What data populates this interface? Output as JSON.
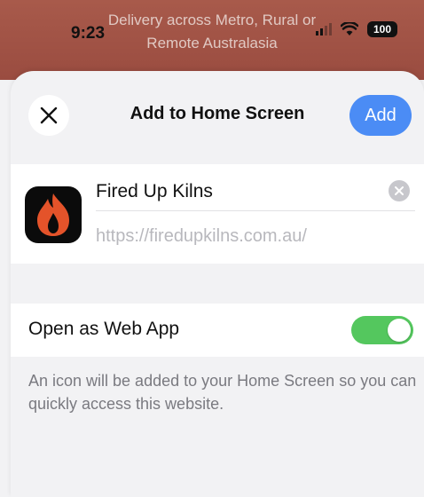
{
  "status": {
    "time": "9:23",
    "battery": "100"
  },
  "banner": {
    "line1": "Delivery across Metro, Rural or",
    "line2": "Remote Australasia"
  },
  "sheet": {
    "title": "Add to Home Screen",
    "add_label": "Add",
    "app_name": "Fired Up Kilns",
    "url": "https://firedupkilns.com.au/",
    "open_as_web_app_label": "Open as Web App",
    "open_as_web_app_enabled": true,
    "toggle_color": "#54c75e",
    "add_button_color": "#4b8cf5",
    "footnote": "An icon will be added to your Home Screen so you can quickly access this website."
  },
  "icons": {
    "close": "close-icon",
    "clear": "clear-text-icon",
    "app": "flame-app-icon",
    "wifi": "wifi-icon",
    "signal": "cellular-signal-icon",
    "battery": "battery-icon"
  }
}
